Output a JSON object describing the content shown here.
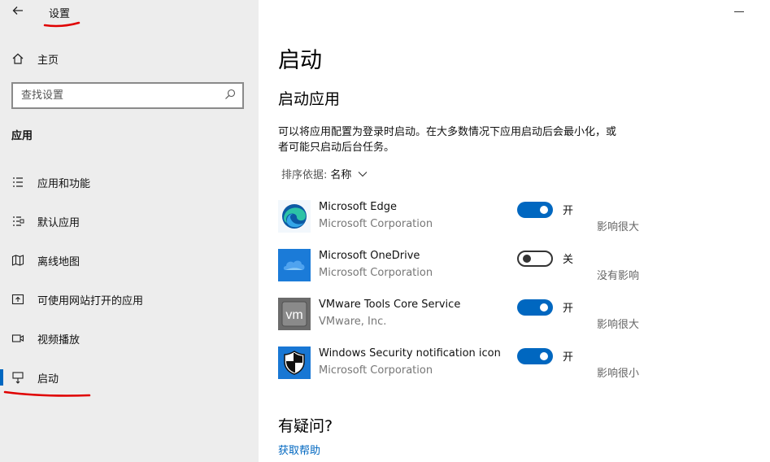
{
  "window": {
    "title": "设置",
    "back_icon": "back-arrow-icon",
    "minimize_icon": "minimize-icon"
  },
  "sidebar": {
    "home": {
      "label": "主页",
      "icon": "home-icon"
    },
    "search": {
      "placeholder": "查找设置",
      "icon": "search-icon"
    },
    "section": "应用",
    "items": [
      {
        "label": "应用和功能",
        "icon": "apps-features-icon",
        "active": false
      },
      {
        "label": "默认应用",
        "icon": "default-apps-icon",
        "active": false
      },
      {
        "label": "离线地图",
        "icon": "offline-maps-icon",
        "active": false
      },
      {
        "label": "可使用网站打开的应用",
        "icon": "apps-for-websites-icon",
        "active": false
      },
      {
        "label": "视频播放",
        "icon": "video-playback-icon",
        "active": false
      },
      {
        "label": "启动",
        "icon": "startup-icon",
        "active": true
      }
    ]
  },
  "main": {
    "title": "启动",
    "subtitle": "启动应用",
    "description_line1": "可以将应用配置为登录时启动。在大多数情况下应用启动后会最小化，或",
    "description_line2": "者可能只启动后台任务。",
    "sort": {
      "label": "排序依据:",
      "value": "名称"
    },
    "apps": [
      {
        "name": "Microsoft Edge",
        "publisher": "Microsoft Corporation",
        "enabled": true,
        "state": "开",
        "impact": "影响很大",
        "icon": "microsoft-edge-icon"
      },
      {
        "name": "Microsoft OneDrive",
        "publisher": "Microsoft Corporation",
        "enabled": false,
        "state": "关",
        "impact": "没有影响",
        "icon": "onedrive-icon"
      },
      {
        "name": "VMware Tools Core Service",
        "publisher": "VMware, Inc.",
        "enabled": true,
        "state": "开",
        "impact": "影响很大",
        "icon": "vmware-icon"
      },
      {
        "name": "Windows Security notification icon",
        "publisher": "Microsoft Corporation",
        "enabled": true,
        "state": "开",
        "impact": "影响很小",
        "icon": "windows-security-shield-icon"
      }
    ],
    "help": {
      "title": "有疑问?",
      "link": "获取帮助"
    }
  },
  "colors": {
    "accent": "#0067c0",
    "sidebar_bg": "#ededed",
    "annotation_red": "#e00000"
  }
}
